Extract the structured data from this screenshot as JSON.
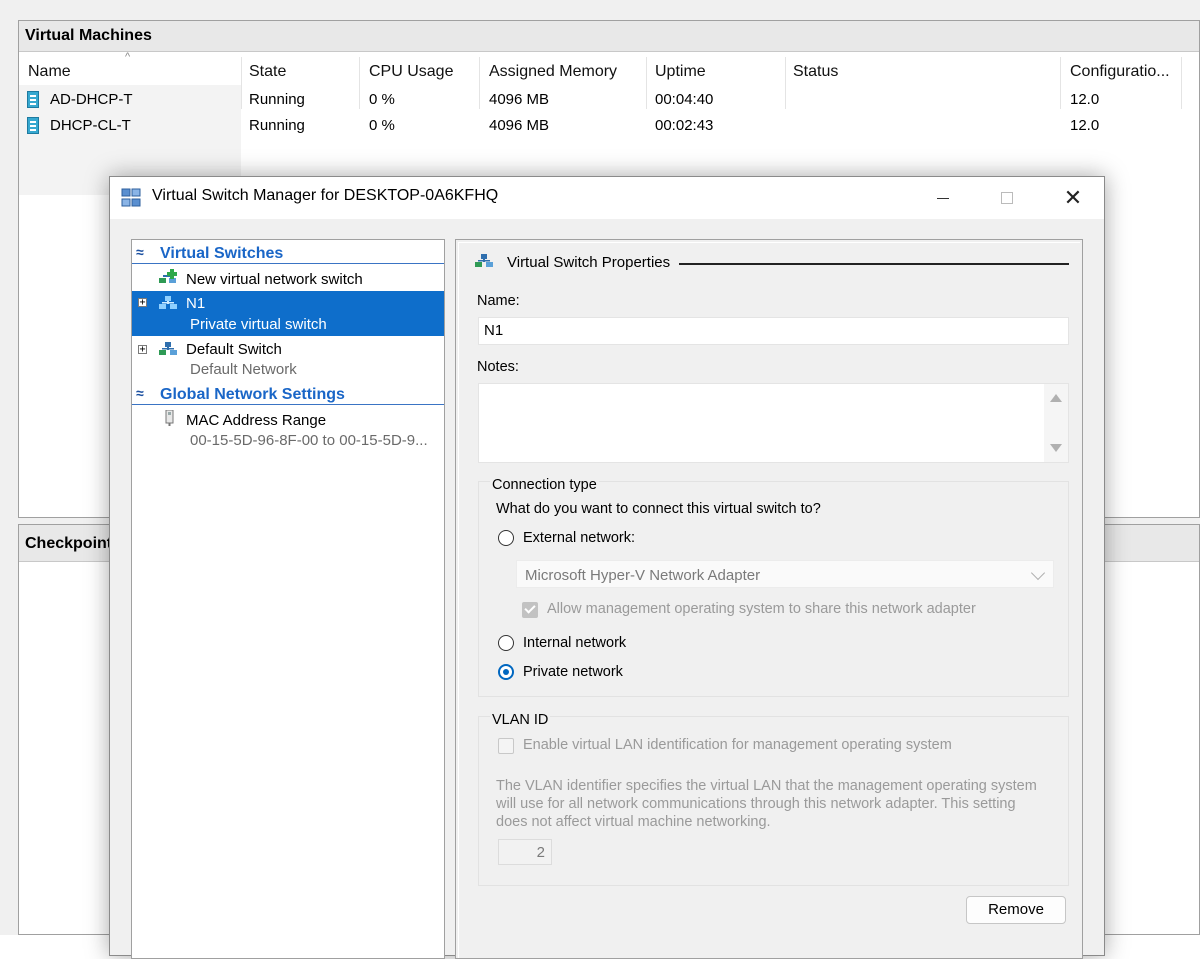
{
  "vm_panel": {
    "title": "Virtual Machines",
    "columns": [
      "Name",
      "State",
      "CPU Usage",
      "Assigned Memory",
      "Uptime",
      "Status",
      "Configuratio..."
    ],
    "rows": [
      {
        "name": "AD-DHCP-T",
        "state": "Running",
        "cpu": "0 %",
        "memory": "4096 MB",
        "uptime": "00:04:40",
        "status": "",
        "config": "12.0"
      },
      {
        "name": "DHCP-CL-T",
        "state": "Running",
        "cpu": "0 %",
        "memory": "4096 MB",
        "uptime": "00:02:43",
        "status": "",
        "config": "12.0"
      }
    ]
  },
  "checkpoints_panel": {
    "title": "Checkpoint"
  },
  "dialog": {
    "title": "Virtual Switch Manager for DESKTOP-0A6KFHQ",
    "tree": {
      "section_switches": "Virtual Switches",
      "new_switch": "New virtual network switch",
      "items": [
        {
          "name": "N1",
          "sub": "Private virtual switch"
        },
        {
          "name": "Default Switch",
          "sub": "Default Network"
        }
      ],
      "section_global": "Global Network Settings",
      "mac_range": {
        "name": "MAC Address Range",
        "sub": "00-15-5D-96-8F-00 to 00-15-5D-9..."
      }
    },
    "properties": {
      "header": "Virtual Switch Properties",
      "name_label": "Name:",
      "name_value": "N1",
      "notes_label": "Notes:",
      "connection_type_label": "Connection type",
      "connection_question": "What do you want to connect this virtual switch to?",
      "external_label": "External network:",
      "adapter_value": "Microsoft Hyper-V Network Adapter",
      "allow_mgmt_label": "Allow management operating system to share this network adapter",
      "internal_label": "Internal network",
      "private_label": "Private network",
      "selected_connection": "Private network",
      "vlan_label": "VLAN ID",
      "vlan_enable_label": "Enable virtual LAN identification for management operating system",
      "vlan_description": "The VLAN identifier specifies the virtual LAN that the management operating system will use for all network communications through this network adapter. This setting does not affect virtual machine networking.",
      "vlan_value": "2",
      "remove_label": "Remove"
    }
  },
  "colors": {
    "selection": "#0e6ecb",
    "section_text": "#1a66c7",
    "radio_accent": "#0067c0"
  }
}
